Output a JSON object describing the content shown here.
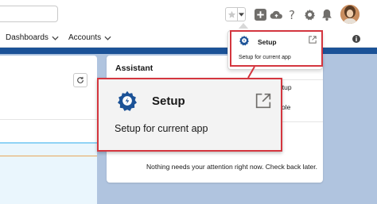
{
  "nav": {
    "dashboards_label": "Dashboards",
    "accounts_label": "Accounts"
  },
  "assistant": {
    "title": "Assistant",
    "fragment_1": "etup",
    "fragment_2": "ole",
    "empty_message": "Nothing needs your attention right now. Check back later."
  },
  "setup_menu": {
    "setup_label": "Setup",
    "setup_description": "Setup for current app"
  },
  "zoom_callout": {
    "setup_label": "Setup",
    "setup_description": "Setup for current app"
  },
  "icons": {
    "favorite": "star-icon",
    "favorite_dropdown": "chevron-down-icon",
    "add": "plus-icon",
    "trailhead": "cloud-icon",
    "help": "question-icon",
    "setup": "gear-icon",
    "notifications": "bell-icon",
    "info": "info-icon",
    "refresh": "refresh-icon",
    "external": "external-link-icon"
  },
  "colors": {
    "accent_red": "#d4363f",
    "brand_blue": "#1b5297",
    "gear_blue": "#1b5297"
  }
}
